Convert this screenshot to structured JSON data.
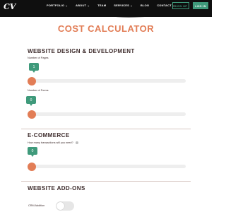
{
  "header": {
    "logo": "CV",
    "nav": [
      "PORTFOLIO ⌄",
      "ABOUT ⌄",
      "TEAM",
      "SERVICES ⌄",
      "BLOG",
      "CONTACT ⌄"
    ],
    "signup_label": "SIGN UP",
    "login_label": "LOG IN"
  },
  "page": {
    "title": "COST CALCULATOR"
  },
  "sections": [
    {
      "title": "WEBSITE DESIGN & DEVELOPMENT",
      "fields": [
        {
          "label": "Number of Pages",
          "value": "1",
          "fraction": 0.0
        },
        {
          "label": "Number of Forms",
          "value": "0",
          "fraction": 0.0
        }
      ]
    },
    {
      "title": "E-COMMERCE",
      "fields": [
        {
          "label": "How many transactions will you need?",
          "value": "0",
          "fraction": 0.0
        }
      ]
    },
    {
      "title": "WEBSITE ADD-ONS",
      "fields": [
        {
          "label": "CRM Addition",
          "toggled": false
        }
      ]
    }
  ],
  "colors": {
    "accent": "#e27d56",
    "green": "#3f9a7b",
    "header_bg": "#0f0f0f",
    "text": "#3d2b2b"
  }
}
